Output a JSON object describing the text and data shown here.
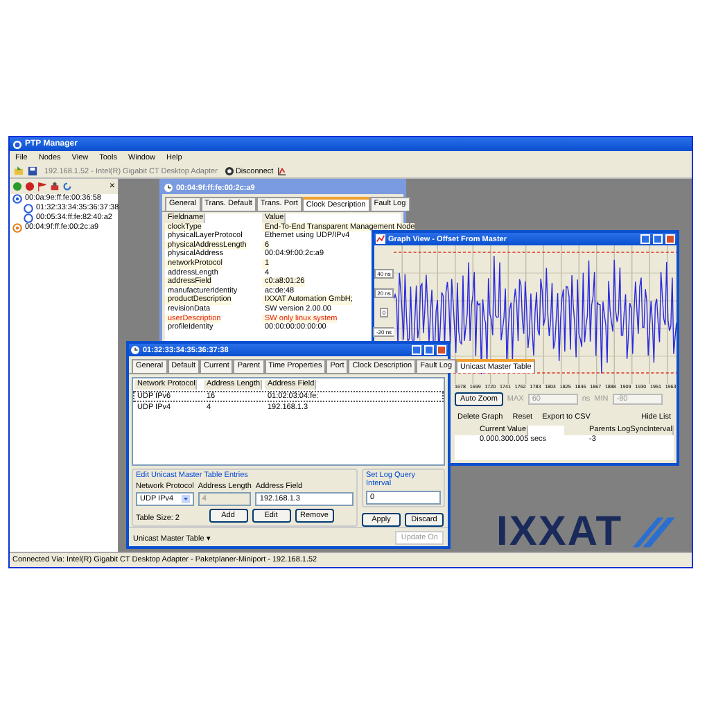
{
  "window": {
    "title": "PTP Manager"
  },
  "menu": [
    "File",
    "Nodes",
    "View",
    "Tools",
    "Window",
    "Help"
  ],
  "toolbar": {
    "adapter": "192.168.1.52 - Intel(R) Gigabit CT Desktop Adapter",
    "disconnect": "Disconnect"
  },
  "node_panel": {
    "close": "×",
    "tree": [
      {
        "label": "00:0a:9e:ff:fe:00:36:58",
        "expanded": true,
        "children": [
          {
            "label": "01:32:33:34:35:36:37:38"
          },
          {
            "label": "00:05:34:ff:fe:82:40:a2"
          }
        ]
      },
      {
        "label": "00:04:9f:ff:fe:00:2c:a9",
        "expanded": false
      }
    ]
  },
  "clock_window": {
    "title": "00:04:9f:ff:fe:00:2c:a9",
    "tabs": [
      {
        "label": "General",
        "selected": false
      },
      {
        "label": "Trans. Default",
        "selected": false
      },
      {
        "label": "Trans. Port",
        "selected": false
      },
      {
        "label": "Clock Description",
        "selected": true
      },
      {
        "label": "Fault Log",
        "selected": false
      }
    ],
    "columns": [
      "Fieldname",
      "Value"
    ],
    "rows": [
      {
        "field": "clockType",
        "value": "End-To-End Transparent Management Node",
        "highlight": false
      },
      {
        "field": "physicalLayerProtocol",
        "value": "Ethernet using UDP/IPv4",
        "highlight": false
      },
      {
        "field": "physicalAddressLength",
        "value": "6",
        "highlight": false
      },
      {
        "field": "physicalAddress",
        "value": "00:04:9f:00:2c:a9",
        "highlight": false
      },
      {
        "field": "networkProtocol",
        "value": "1",
        "highlight": false
      },
      {
        "field": "addressLength",
        "value": "4",
        "highlight": false
      },
      {
        "field": "addressField",
        "value": "c0:a8:01:26",
        "highlight": false
      },
      {
        "field": "manufacturerIdentity",
        "value": "ac:de:48",
        "highlight": false
      },
      {
        "field": "productDescription",
        "value": "IXXAT Automation GmbH;",
        "highlight": false
      },
      {
        "field": "revisionData",
        "value": "SW version 2.00.00",
        "highlight": false
      },
      {
        "field": "userDescription",
        "value": "SW only linux system",
        "highlight": true
      },
      {
        "field": "profileIdentity",
        "value": "00:00:00:00:00:00",
        "highlight": false
      }
    ]
  },
  "graph_window": {
    "title": "Graph View - Offset From Master",
    "y_labels": [
      "40 ns",
      "20 ns",
      "0",
      "-20 ns"
    ],
    "x_labels": [
      "1678",
      "1699",
      "1720",
      "1741",
      "1762",
      "1783",
      "1804",
      "1825",
      "1846",
      "1867",
      "1888",
      "1909",
      "1930",
      "1951",
      "1963"
    ],
    "auto_zoom": "Auto Zoom",
    "max_label": "MAX",
    "max_value": "60",
    "unit": "ns",
    "min_label": "MIN",
    "min_value": "-80",
    "buttons": [
      "Delete Graph",
      "Reset",
      "Export to CSV"
    ],
    "hide_list": "Hide List",
    "columns": [
      "Current Value",
      "Parents LogSyncInterval"
    ],
    "rows": [
      [
        "0.000.300.005 secs",
        "-3"
      ]
    ]
  },
  "unicast_window": {
    "title": "01:32:33:34:35:36:37:38",
    "tabs": [
      {
        "label": "General",
        "selected": false
      },
      {
        "label": "Default",
        "selected": false
      },
      {
        "label": "Current",
        "selected": false
      },
      {
        "label": "Parent",
        "selected": false
      },
      {
        "label": "Time Properties",
        "selected": false
      },
      {
        "label": "Port",
        "selected": false
      },
      {
        "label": "Clock Description",
        "selected": false
      },
      {
        "label": "Fault Log",
        "selected": false
      },
      {
        "label": "Unicast Master Table",
        "selected": true
      }
    ],
    "columns": [
      "Network Protocol",
      "Address Length",
      "Address Field"
    ],
    "rows": [
      {
        "cells": [
          "UDP IPv6",
          "16",
          "01:02:03:04:fe:"
        ],
        "selected": true
      },
      {
        "cells": [
          "UDP IPv4",
          "4",
          "192.168.1.3"
        ],
        "selected": false
      }
    ],
    "edit_group": {
      "title": "Edit Unicast Master Table Entries",
      "protocol_label": "Network Protocol",
      "protocol": "UDP IPv4",
      "length_label": "Address Length",
      "length": "4",
      "field_label": "Address Field",
      "field": "192.168.1.3",
      "table_size": "Table Size: 2",
      "buttons": [
        "Add",
        "Edit",
        "Remove"
      ]
    },
    "interval_group": {
      "title": "Set Log Query Interval",
      "value": "0"
    },
    "actions": [
      "Apply",
      "Discard"
    ],
    "footer": "Unicast Master Table ▾",
    "update": "Update On"
  },
  "logo": "IXXAT",
  "status_bar": "Connected Via: Intel(R) Gigabit CT Desktop Adapter - Paketplaner-Miniport - 192.168.1.52"
}
